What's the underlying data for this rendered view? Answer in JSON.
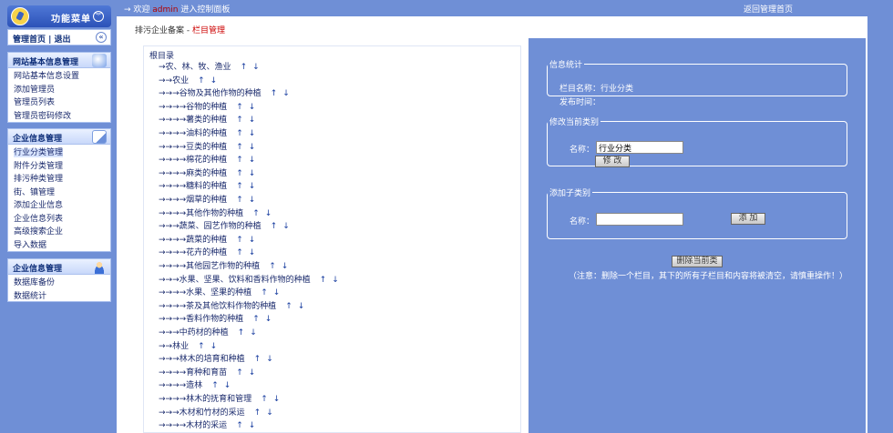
{
  "sidebar": {
    "title": "功能菜单",
    "manager_bar": "管理首页 | 退出",
    "groups": [
      {
        "title": "网站基本信息管理",
        "items": [
          "网站基本信息设置",
          "添加管理员",
          "管理员列表",
          "管理员密码修改"
        ]
      },
      {
        "title": "企业信息管理",
        "items": [
          "行业分类管理",
          "附件分类管理",
          "排污种类管理",
          "街、镇管理",
          "添加企业信息",
          "企业信息列表",
          "高级搜索企业",
          "导入数据"
        ]
      },
      {
        "title": "企业信息管理",
        "items": [
          "数据库备份",
          "数据统计"
        ]
      }
    ]
  },
  "topbar": {
    "prefix": "→ 欢迎",
    "user": "admin",
    "suffix": "进入控制面板",
    "back_link": "返回管理首页"
  },
  "breadcrumb": {
    "parent": "排污企业备案 - ",
    "current": "栏目管理"
  },
  "tree": {
    "root": "根目录",
    "rows": [
      {
        "prefix": "→",
        "label": "农、林、牧、渔业"
      },
      {
        "prefix": "→→",
        "label": "农业"
      },
      {
        "prefix": "→→→",
        "label": "谷物及其他作物的种植"
      },
      {
        "prefix": "→→→→",
        "label": "谷物的种植"
      },
      {
        "prefix": "→→→→",
        "label": "薯类的种植"
      },
      {
        "prefix": "→→→→",
        "label": "油料的种植"
      },
      {
        "prefix": "→→→→",
        "label": "豆类的种植"
      },
      {
        "prefix": "→→→→",
        "label": "棉花的种植"
      },
      {
        "prefix": "→→→→",
        "label": "麻类的种植"
      },
      {
        "prefix": "→→→→",
        "label": "糖料的种植"
      },
      {
        "prefix": "→→→→",
        "label": "烟草的种植"
      },
      {
        "prefix": "→→→→",
        "label": "其他作物的种植"
      },
      {
        "prefix": "→→→",
        "label": "蔬菜、园艺作物的种植"
      },
      {
        "prefix": "→→→→",
        "label": "蔬菜的种植"
      },
      {
        "prefix": "→→→→",
        "label": "花卉的种植"
      },
      {
        "prefix": "→→→→",
        "label": "其他园艺作物的种植"
      },
      {
        "prefix": "→→→",
        "label": "水果、坚果、饮料和香料作物的种植"
      },
      {
        "prefix": "→→→→",
        "label": "水果、坚果的种植"
      },
      {
        "prefix": "→→→→",
        "label": "茶及其他饮料作物的种植"
      },
      {
        "prefix": "→→→→",
        "label": "香料作物的种植"
      },
      {
        "prefix": "→→→",
        "label": "中药材的种植"
      },
      {
        "prefix": "→→",
        "label": "林业"
      },
      {
        "prefix": "→→→",
        "label": "林木的培育和种植"
      },
      {
        "prefix": "→→→→",
        "label": "育种和育苗"
      },
      {
        "prefix": "→→→→",
        "label": "造林"
      },
      {
        "prefix": "→→→→",
        "label": "林木的抚育和管理"
      },
      {
        "prefix": "→→→",
        "label": "木材和竹材的采运"
      },
      {
        "prefix": "→→→→",
        "label": "木材的采运"
      }
    ]
  },
  "info": {
    "legend": "信息统计",
    "name_line": "栏目名称：行业分类",
    "time_line": "发布时间："
  },
  "edit": {
    "legend": "修改当前类别",
    "name_label": "名称：",
    "name_value": "行业分类",
    "button": "修 改"
  },
  "add": {
    "legend": "添加子类别",
    "name_label": "名称：",
    "name_value": "",
    "button": "添 加"
  },
  "delete_button": "删除当前类",
  "note": "（注意：删除一个栏目，其下的所有子栏目和内容将被清空，请慎重操作！）",
  "colors": {
    "background": "#6f8fd6",
    "accent_red": "#cc0000"
  }
}
